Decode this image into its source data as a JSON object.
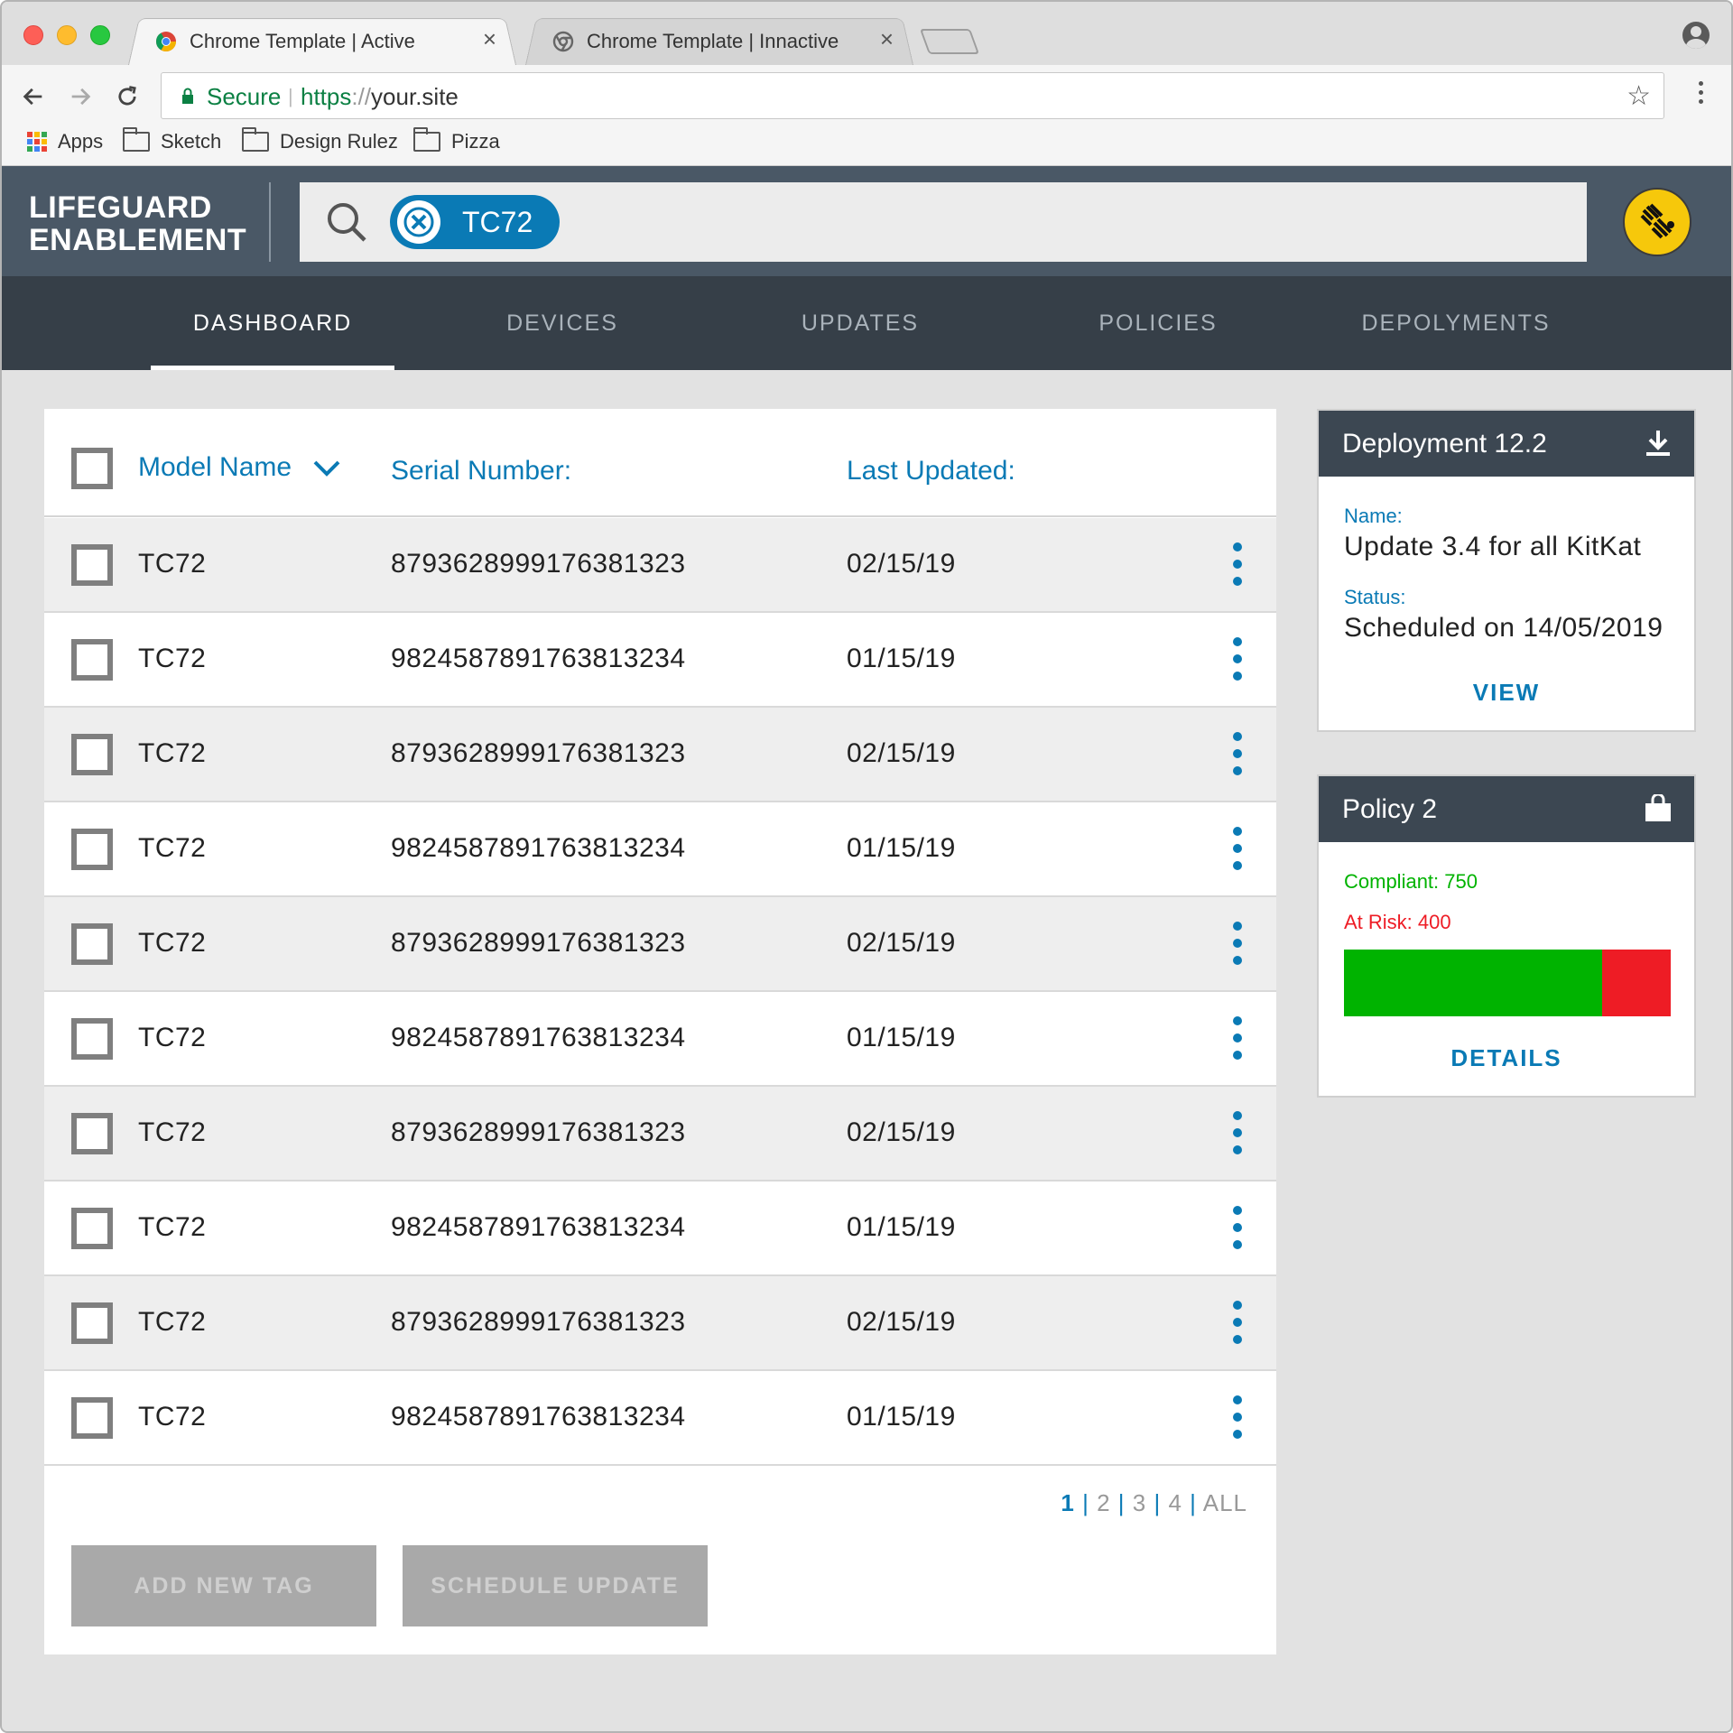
{
  "browser": {
    "tabs": [
      {
        "title": "Chrome Template | Active",
        "close": "×"
      },
      {
        "title": "Chrome Template | Innactive",
        "close": "×"
      }
    ],
    "omnibox": {
      "secure_label": "Secure",
      "separator": "|",
      "scheme": "https",
      "slashes": "://",
      "host": "your.site"
    },
    "bookmarks": [
      "Apps",
      "Sketch",
      "Design Rulez",
      "Pizza"
    ]
  },
  "app": {
    "brand_line1": "LIFEGUARD",
    "brand_line2": "ENABLEMENT",
    "search_chip": "TC72",
    "nav": [
      "DASHBOARD",
      "DEVICES",
      "UPDATES",
      "POLICIES",
      "DEPOLYMENTS"
    ],
    "active_nav": "DASHBOARD"
  },
  "table": {
    "headers": {
      "model": "Model Name",
      "serial": "Serial Number:",
      "updated": "Last Updated:"
    },
    "rows": [
      {
        "model": "TC72",
        "serial": "8793628999176381323",
        "updated": "02/15/19"
      },
      {
        "model": "TC72",
        "serial": "9824587891763813234",
        "updated": "01/15/19"
      },
      {
        "model": "TC72",
        "serial": "8793628999176381323",
        "updated": "02/15/19"
      },
      {
        "model": "TC72",
        "serial": "9824587891763813234",
        "updated": "01/15/19"
      },
      {
        "model": "TC72",
        "serial": "8793628999176381323",
        "updated": "02/15/19"
      },
      {
        "model": "TC72",
        "serial": "9824587891763813234",
        "updated": "01/15/19"
      },
      {
        "model": "TC72",
        "serial": "8793628999176381323",
        "updated": "02/15/19"
      },
      {
        "model": "TC72",
        "serial": "9824587891763813234",
        "updated": "01/15/19"
      },
      {
        "model": "TC72",
        "serial": "8793628999176381323",
        "updated": "02/15/19"
      },
      {
        "model": "TC72",
        "serial": "9824587891763813234",
        "updated": "01/15/19"
      }
    ],
    "pager": {
      "pages": [
        "1",
        "2",
        "3",
        "4",
        "ALL"
      ],
      "current": "1",
      "sep": "|"
    },
    "buttons": {
      "add_tag": "ADD NEW TAG",
      "schedule": "SCHEDULE UPDATE"
    }
  },
  "deployment_card": {
    "title": "Deployment 12.2",
    "name_label": "Name:",
    "name_value": "Update 3.4 for all KitKat",
    "status_label": "Status:",
    "status_value": "Scheduled on 14/05/2019",
    "action": "VIEW"
  },
  "policy_card": {
    "title": "Policy 2",
    "compliant_text": "Compliant: 750",
    "at_risk_text": "At Risk: 400",
    "compliant_fraction": 0.79,
    "action": "DETAILS"
  },
  "colors": {
    "accent": "#0a7ab5",
    "header_bg": "#4a5866",
    "nav_bg": "#363f48",
    "compliant": "#00b300",
    "at_risk": "#ee1c25",
    "brand_yellow": "#f6c80b"
  },
  "icons": [
    "chrome-icon",
    "close-icon",
    "back-icon",
    "forward-icon",
    "reload-icon",
    "lock-icon",
    "star-icon",
    "menu-icon",
    "apps-icon",
    "folder-icon",
    "search-icon",
    "clear-chip-icon",
    "zebra-logo-icon",
    "chevron-down-icon",
    "more-vert-icon",
    "download-icon",
    "bag-icon",
    "profile-icon"
  ]
}
